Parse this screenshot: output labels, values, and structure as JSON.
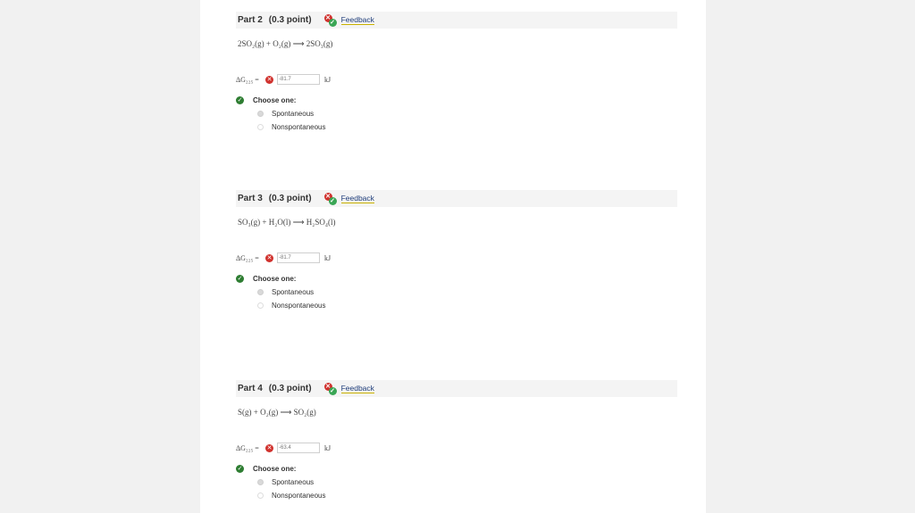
{
  "parts": [
    {
      "title": "Part 2",
      "points": "(0.3 point)",
      "feedback_label": "Feedback",
      "equation": "2SO₂(g) + O₂(g) ⟶ 2SO₃(g)",
      "dg_label": "ΔG₂₂₅ =",
      "dg_value": "-81.7",
      "unit": "kJ",
      "choose_label": "Choose one:",
      "options": [
        "Spontaneous",
        "Nonspontaneous"
      ],
      "selected": "Spontaneous"
    },
    {
      "title": "Part 3",
      "points": "(0.3 point)",
      "feedback_label": "Feedback",
      "equation": "SO₃(g) + H₂O(l) ⟶ H₂SO₄(l)",
      "dg_label": "ΔG₂₂₅ =",
      "dg_value": "-81.7",
      "unit": "kJ",
      "choose_label": "Choose one:",
      "options": [
        "Spontaneous",
        "Nonspontaneous"
      ],
      "selected": "Spontaneous"
    },
    {
      "title": "Part 4",
      "points": "(0.3 point)",
      "feedback_label": "Feedback",
      "equation": "S(g) + O₂(g) ⟶ SO₂(g)",
      "dg_label": "ΔG₂₂₅ =",
      "dg_value": "-63.4",
      "unit": "kJ",
      "choose_label": "Choose one:",
      "options": [
        "Spontaneous",
        "Nonspontaneous"
      ],
      "selected": "Spontaneous"
    }
  ],
  "colors": {
    "error": "#d0312d",
    "correct": "#2e7d32",
    "link": "#1f3d7a"
  },
  "icons": {
    "error": "x-circle-icon",
    "correct": "check-circle-icon",
    "feedback": "feedback-icon"
  }
}
